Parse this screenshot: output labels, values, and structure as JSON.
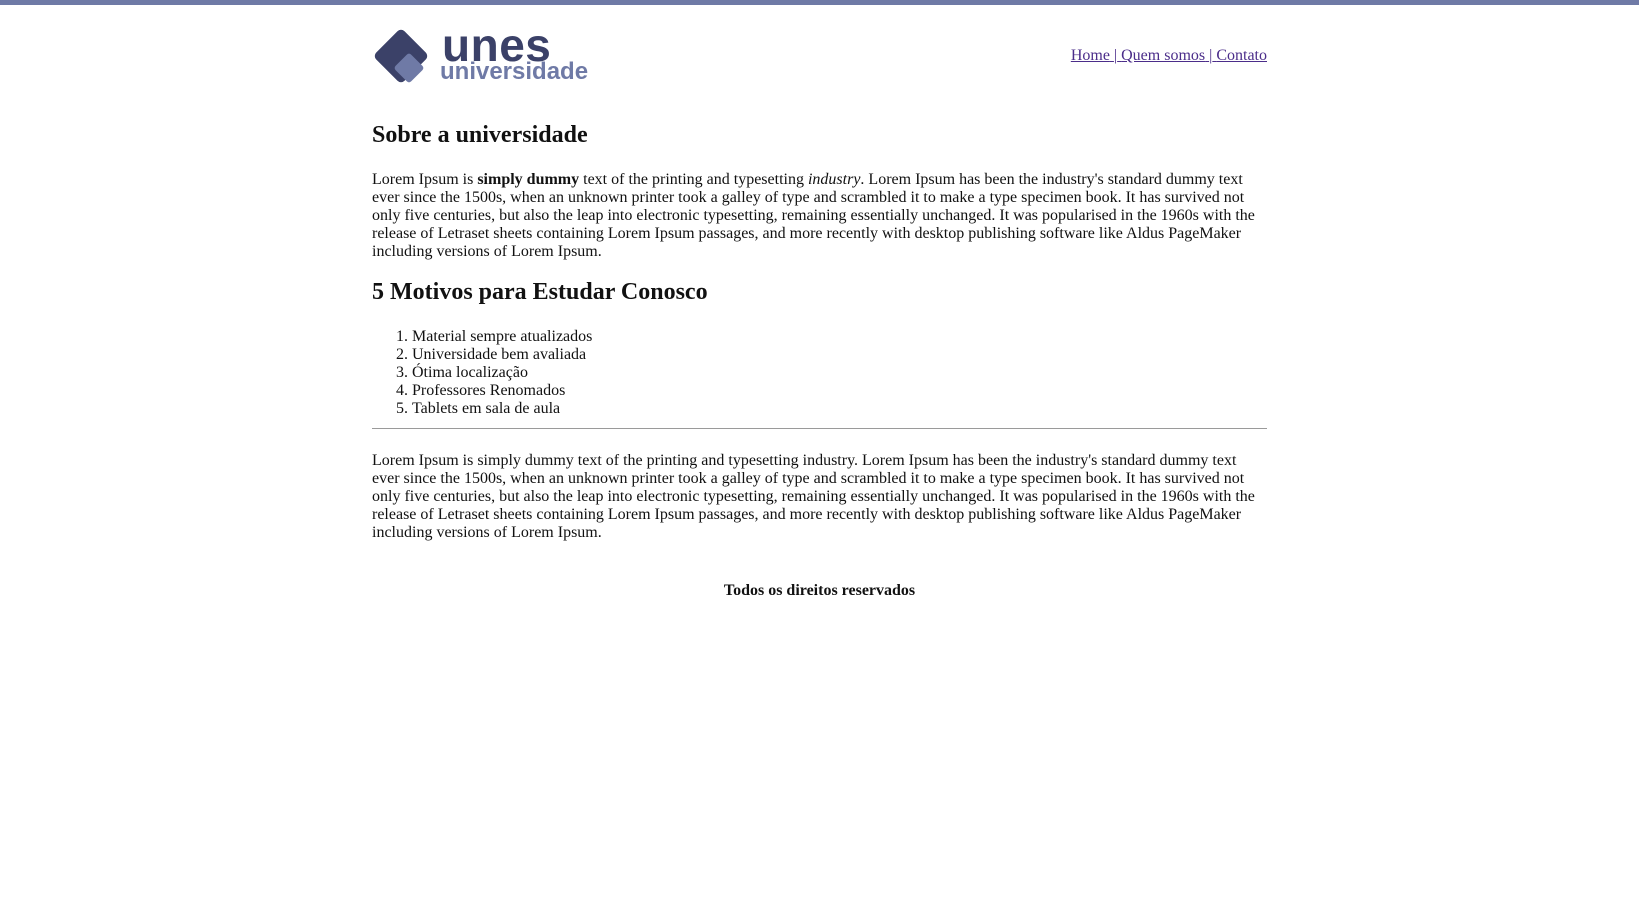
{
  "brand": {
    "logo_title": "unes",
    "logo_subtitle": "universidade",
    "colors": {
      "dark": "#3b4168",
      "light": "#6f7aa6"
    }
  },
  "nav": {
    "items": [
      {
        "label": "Home"
      },
      {
        "label": "Quem somos"
      },
      {
        "label": "Contato"
      }
    ],
    "separator": "|"
  },
  "about": {
    "heading": "Sobre a universidade",
    "p1_start": "Lorem Ipsum is ",
    "p1_bold": "simply dummy",
    "p1_mid": " text of the printing and typesetting ",
    "p1_italic": "industry",
    "p1_rest": ". Lorem Ipsum has been the industry's standard dummy text ever since the 1500s, when an unknown printer took a galley of type and scrambled it to make a type specimen book. It has survived not only five centuries, but also the leap into electronic typesetting, remaining essentially unchanged. It was popularised in the 1960s with the release of Letraset sheets containing Lorem Ipsum passages, and more recently with desktop publishing software like Aldus PageMaker including versions of Lorem Ipsum."
  },
  "reasons": {
    "heading": "5 Motivos para Estudar Conosco",
    "items": [
      "Material sempre atualizados",
      "Universidade bem avaliada",
      "Ótima localização",
      "Professores Renomados",
      "Tablets em sala de aula"
    ]
  },
  "closing": {
    "text": "Lorem Ipsum is simply dummy text of the printing and typesetting industry. Lorem Ipsum has been the industry's standard dummy text ever since the 1500s, when an unknown printer took a galley of type and scrambled it to make a type specimen book. It has survived not only five centuries, but also the leap into electronic typesetting, remaining essentially unchanged. It was popularised in the 1960s with the release of Letraset sheets containing Lorem Ipsum passages, and more recently with desktop publishing software like Aldus PageMaker including versions of Lorem Ipsum."
  },
  "footer": {
    "text": "Todos os direitos reservados"
  }
}
